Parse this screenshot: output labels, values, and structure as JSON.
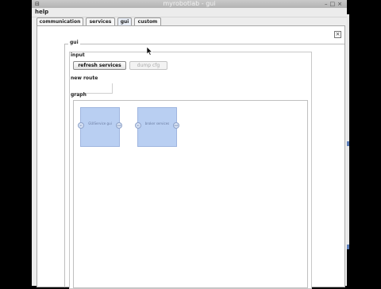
{
  "window": {
    "title": "myrobotlab - gui"
  },
  "menu": {
    "help_label": "help"
  },
  "tabs": [
    "communication",
    "services",
    "gui",
    "custom"
  ],
  "active_tab": "gui",
  "panel": {
    "title": "gui",
    "close_glyph": "×",
    "input_label": "input",
    "refresh_button": "refresh services",
    "dump_button": "dump cfg",
    "dump_enabled": false,
    "new_route_label": "new route",
    "graph_label": "graph"
  },
  "graph": {
    "nodes": [
      {
        "label": "GUIService gui",
        "in_port": "in",
        "out_port": "out"
      },
      {
        "label": "broker services",
        "in_port": "in",
        "out_port": "out"
      }
    ]
  },
  "colors": {
    "node_fill": "#b9cff2",
    "accent": "#5b7db8"
  },
  "icons": {
    "close": "close-icon",
    "cursor": "mouse-pointer-icon"
  }
}
